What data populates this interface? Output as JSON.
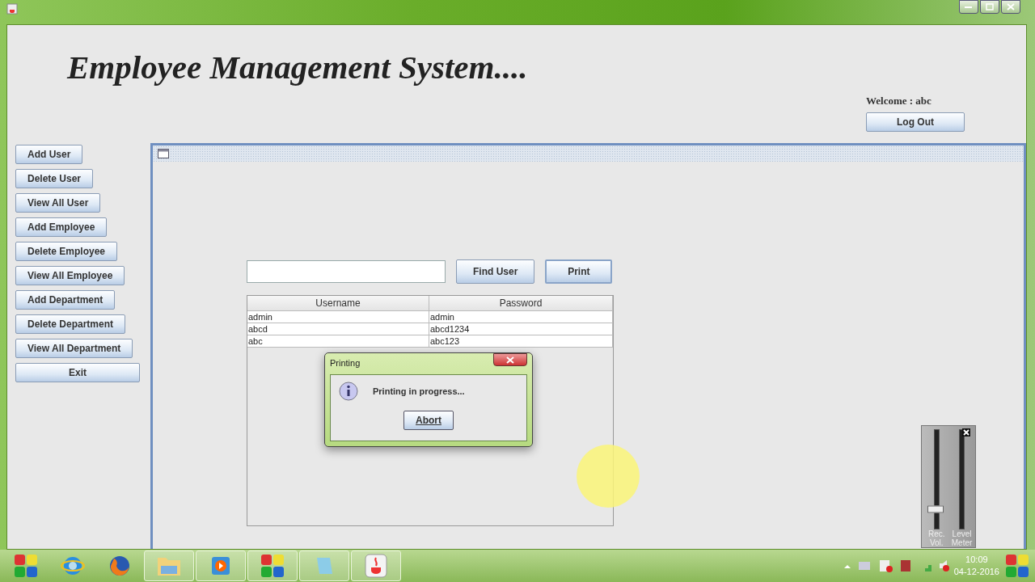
{
  "app_title": "Employee Management System....",
  "welcome": "Welcome : abc",
  "logout_button": "Log Out",
  "sidebar": [
    "Add User",
    "Delete User",
    "View All User",
    "Add Employee",
    "Delete Employee",
    "View All Employee",
    "Add Department",
    "Delete Department",
    "View All Department",
    "Exit"
  ],
  "find_button": "Find User",
  "print_button": "Print",
  "table": {
    "columns": [
      "Username",
      "Password"
    ],
    "rows": [
      [
        "admin",
        "admin"
      ],
      [
        "abcd",
        "abcd1234"
      ],
      [
        "abc",
        "abc123"
      ]
    ]
  },
  "dialog": {
    "title": "Printing",
    "message": "Printing in progress...",
    "button": "Abort"
  },
  "volume_widget": {
    "labels": [
      "Rec.\nVol.",
      "Level\nMeter"
    ],
    "level": 0.2
  },
  "taskbar": {
    "pinned": [
      {
        "kind": "logo"
      },
      {
        "kind": "browser-e"
      },
      {
        "kind": "browser-fox"
      },
      {
        "kind": "folder"
      },
      {
        "kind": "media"
      },
      {
        "kind": "logo"
      },
      {
        "kind": "notepad"
      },
      {
        "kind": "java"
      }
    ],
    "time": "10:09",
    "date": "04-12-2016"
  }
}
